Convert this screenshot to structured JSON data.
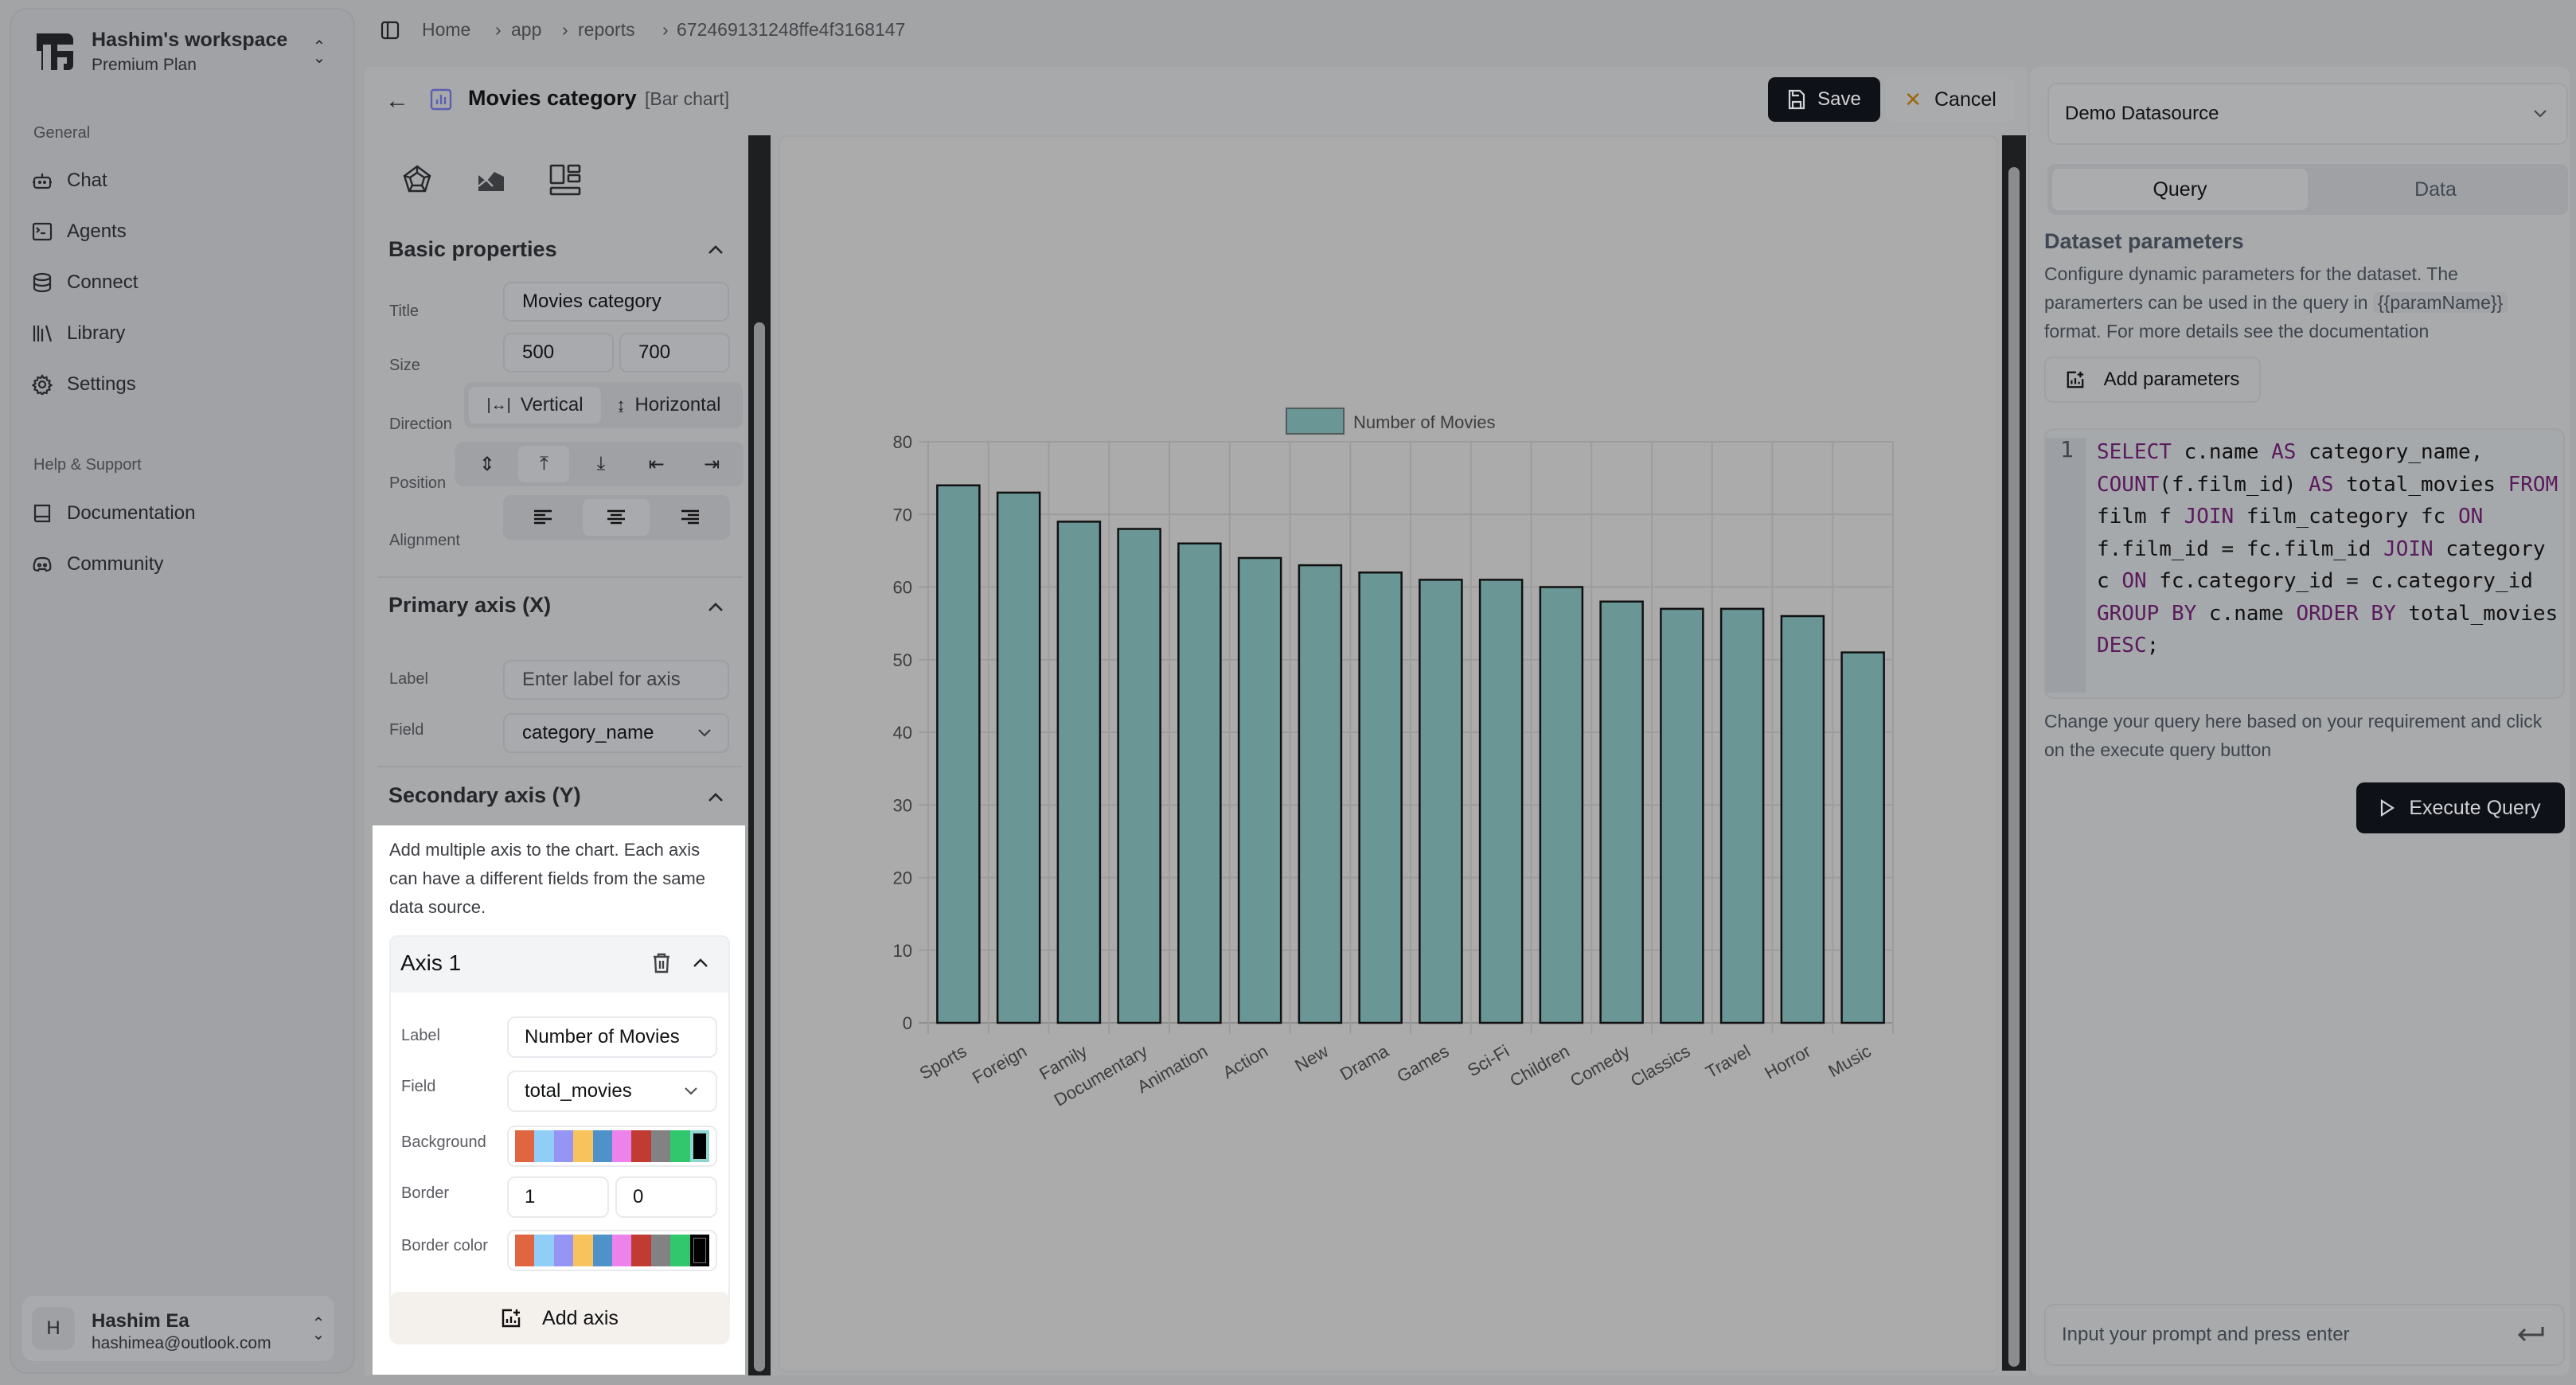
{
  "workspace": {
    "name": "Hashim's workspace",
    "plan": "Premium Plan"
  },
  "sidebar": {
    "general_label": "General",
    "items": [
      {
        "label": "Chat",
        "icon": "bot-icon"
      },
      {
        "label": "Agents",
        "icon": "terminal-icon"
      },
      {
        "label": "Connect",
        "icon": "database-icon"
      },
      {
        "label": "Library",
        "icon": "library-icon"
      },
      {
        "label": "Settings",
        "icon": "gear-icon"
      }
    ],
    "help_label": "Help & Support",
    "help_items": [
      {
        "label": "Documentation",
        "icon": "book-icon"
      },
      {
        "label": "Community",
        "icon": "discord-icon"
      }
    ]
  },
  "user": {
    "initial": "H",
    "name": "Hashim Ea",
    "email": "hashimea@outlook.com"
  },
  "breadcrumb": [
    "Home",
    "app",
    "reports",
    "672469131248ffe4f3168147"
  ],
  "header": {
    "title": "Movies category",
    "subtitle": "[Bar chart]",
    "save_label": "Save",
    "cancel_label": "Cancel"
  },
  "config": {
    "basic": {
      "title": "Basic properties",
      "title_label": "Title",
      "title_value": "Movies category",
      "size_label": "Size",
      "width": "500",
      "height": "700",
      "direction_label": "Direction",
      "direction_options": [
        "Vertical",
        "Horizontal"
      ],
      "direction_selected": "Vertical",
      "position_label": "Position",
      "position_selected": "top",
      "alignment_label": "Alignment",
      "alignment_selected": "center"
    },
    "primary_axis": {
      "title": "Primary axis (X)",
      "label_label": "Label",
      "label_placeholder": "Enter label for axis",
      "field_label": "Field",
      "field_value": "category_name"
    },
    "secondary_axis": {
      "title": "Secondary axis (Y)",
      "description": "Add multiple axis to the chart. Each axis can have a different fields from the same data source.",
      "axes": [
        {
          "title": "Axis 1",
          "label_label": "Label",
          "label_value": "Number of Movies",
          "field_label": "Field",
          "field_value": "total_movies",
          "background_label": "Background",
          "border_label": "Border",
          "border_width": "1",
          "border_radius": "0",
          "border_color_label": "Border color"
        }
      ],
      "add_axis_label": "Add axis",
      "palette": [
        "#e06641",
        "#90cdf7",
        "#9694f5",
        "#f8c35c",
        "#4f91c9",
        "#ed82ec",
        "#c03c32",
        "#828282",
        "#31c86d",
        "#000000"
      ],
      "background_selected": "#000000",
      "border_color_selected": "#000000"
    }
  },
  "chart_data": {
    "type": "bar",
    "title": "",
    "legend": [
      "Number of Movies"
    ],
    "legend_position": "top",
    "categories": [
      "Sports",
      "Foreign",
      "Family",
      "Documentary",
      "Animation",
      "Action",
      "New",
      "Drama",
      "Games",
      "Sci-Fi",
      "Children",
      "Comedy",
      "Classics",
      "Travel",
      "Horror",
      "Music"
    ],
    "series": [
      {
        "name": "Number of Movies",
        "values": [
          74,
          73,
          69,
          68,
          66,
          64,
          63,
          62,
          61,
          61,
          60,
          58,
          57,
          57,
          56,
          51
        ],
        "color": "#6a9696",
        "border": "#111111"
      }
    ],
    "xlabel": "",
    "ylabel": "",
    "ylim": [
      0,
      80
    ],
    "yticks": [
      0,
      10,
      20,
      30,
      40,
      50,
      60,
      70,
      80
    ],
    "grid": true
  },
  "right_panel": {
    "datasource": "Demo Datasource",
    "tabs": [
      "Query",
      "Data"
    ],
    "active_tab": "Query",
    "params_title": "Dataset parameters",
    "params_desc_1": "Configure dynamic parameters for the dataset. The paramerters can be used in the query in",
    "params_code": "{{paramName}}",
    "params_desc_2": "format. For more details see the documentation",
    "add_params_label": "Add parameters",
    "query_line_number": "1",
    "query": "SELECT c.name AS category_name, COUNT(f.film_id) AS total_movies FROM film f JOIN film_category fc ON f.film_id = fc.film_id JOIN category c ON fc.category_id = c.category_id GROUP BY c.name ORDER BY total_movies DESC;",
    "hint": "Change your query here based on your requirement and click on the execute query button",
    "execute_label": "Execute Query",
    "prompt_placeholder": "Input your prompt and press enter"
  }
}
